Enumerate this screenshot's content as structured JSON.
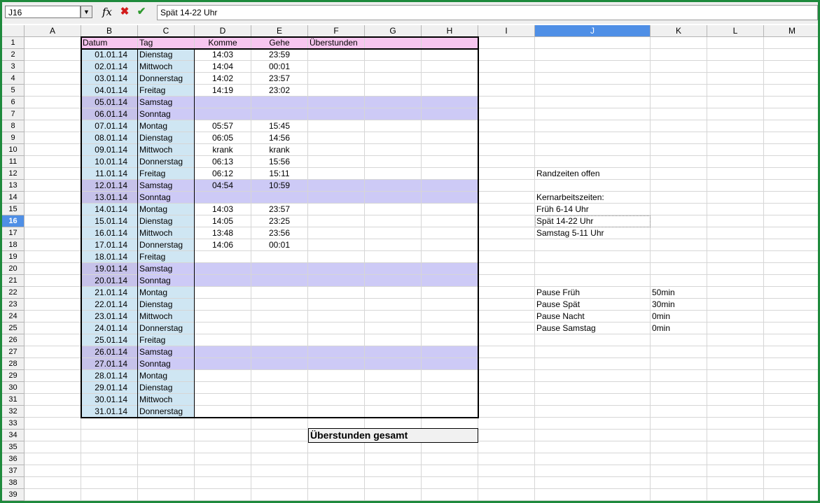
{
  "toolbar": {
    "cell_ref": "J16",
    "formula": "Spät 14-22 Uhr",
    "fx_icon": "function-wizard-icon",
    "cancel_icon": "cancel-x-icon",
    "accept_icon": "accept-check-icon"
  },
  "columns": [
    "A",
    "B",
    "C",
    "D",
    "E",
    "F",
    "G",
    "H",
    "I",
    "J",
    "K",
    "L",
    "M"
  ],
  "rows": [
    "1",
    "2",
    "3",
    "4",
    "5",
    "6",
    "7",
    "8",
    "9",
    "10",
    "11",
    "12",
    "13",
    "14",
    "15",
    "16",
    "17",
    "18",
    "19",
    "20",
    "21",
    "22",
    "23",
    "24",
    "25",
    "26",
    "27",
    "28",
    "29",
    "30",
    "31",
    "32",
    "33",
    "34",
    "35",
    "36",
    "37",
    "38",
    "39"
  ],
  "selected": {
    "column": "J",
    "row": "16"
  },
  "headers": {
    "datum": "Datum",
    "tag": "Tag",
    "komme": "Komme",
    "gehe": "Gehe",
    "ueberstunden": "Überstunden"
  },
  "entries": [
    {
      "date": "01.01.14",
      "day": "Dienstag",
      "in": "14:03",
      "out": "23:59",
      "weekend": false
    },
    {
      "date": "02.01.14",
      "day": "Mittwoch",
      "in": "14:04",
      "out": "00:01",
      "weekend": false
    },
    {
      "date": "03.01.14",
      "day": "Donnerstag",
      "in": "14:02",
      "out": "23:57",
      "weekend": false
    },
    {
      "date": "04.01.14",
      "day": "Freitag",
      "in": "14:19",
      "out": "23:02",
      "weekend": false
    },
    {
      "date": "05.01.14",
      "day": "Samstag",
      "in": "",
      "out": "",
      "weekend": true
    },
    {
      "date": "06.01.14",
      "day": "Sonntag",
      "in": "",
      "out": "",
      "weekend": true
    },
    {
      "date": "07.01.14",
      "day": "Montag",
      "in": "05:57",
      "out": "15:45",
      "weekend": false
    },
    {
      "date": "08.01.14",
      "day": "Dienstag",
      "in": "06:05",
      "out": "14:56",
      "weekend": false
    },
    {
      "date": "09.01.14",
      "day": "Mittwoch",
      "in": "krank",
      "out": "krank",
      "weekend": false
    },
    {
      "date": "10.01.14",
      "day": "Donnerstag",
      "in": "06:13",
      "out": "15:56",
      "weekend": false
    },
    {
      "date": "11.01.14",
      "day": "Freitag",
      "in": "06:12",
      "out": "15:11",
      "weekend": false
    },
    {
      "date": "12.01.14",
      "day": "Samstag",
      "in": "04:54",
      "out": "10:59",
      "weekend": true
    },
    {
      "date": "13.01.14",
      "day": "Sonntag",
      "in": "",
      "out": "",
      "weekend": true
    },
    {
      "date": "14.01.14",
      "day": "Montag",
      "in": "14:03",
      "out": "23:57",
      "weekend": false
    },
    {
      "date": "15.01.14",
      "day": "Dienstag",
      "in": "14:05",
      "out": "23:25",
      "weekend": false
    },
    {
      "date": "16.01.14",
      "day": "Mittwoch",
      "in": "13:48",
      "out": "23:56",
      "weekend": false
    },
    {
      "date": "17.01.14",
      "day": "Donnerstag",
      "in": "14:06",
      "out": "00:01",
      "weekend": false
    },
    {
      "date": "18.01.14",
      "day": "Freitag",
      "in": "",
      "out": "",
      "weekend": false
    },
    {
      "date": "19.01.14",
      "day": "Samstag",
      "in": "",
      "out": "",
      "weekend": true
    },
    {
      "date": "20.01.14",
      "day": "Sonntag",
      "in": "",
      "out": "",
      "weekend": true
    },
    {
      "date": "21.01.14",
      "day": "Montag",
      "in": "",
      "out": "",
      "weekend": false
    },
    {
      "date": "22.01.14",
      "day": "Dienstag",
      "in": "",
      "out": "",
      "weekend": false
    },
    {
      "date": "23.01.14",
      "day": "Mittwoch",
      "in": "",
      "out": "",
      "weekend": false
    },
    {
      "date": "24.01.14",
      "day": "Donnerstag",
      "in": "",
      "out": "",
      "weekend": false
    },
    {
      "date": "25.01.14",
      "day": "Freitag",
      "in": "",
      "out": "",
      "weekend": false
    },
    {
      "date": "26.01.14",
      "day": "Samstag",
      "in": "",
      "out": "",
      "weekend": true
    },
    {
      "date": "27.01.14",
      "day": "Sonntag",
      "in": "",
      "out": "",
      "weekend": true
    },
    {
      "date": "28.01.14",
      "day": "Montag",
      "in": "",
      "out": "",
      "weekend": false
    },
    {
      "date": "29.01.14",
      "day": "Dienstag",
      "in": "",
      "out": "",
      "weekend": false
    },
    {
      "date": "30.01.14",
      "day": "Mittwoch",
      "in": "",
      "out": "",
      "weekend": false
    },
    {
      "date": "31.01.14",
      "day": "Donnerstag",
      "in": "",
      "out": "",
      "weekend": false
    }
  ],
  "total_label": "Überstunden gesamt",
  "notes": {
    "randzeiten": "Randzeiten offen",
    "kern_title": "Kernarbeitszeiten:",
    "frueh": "Früh 6-14 Uhr",
    "spaet": "Spät 14-22 Uhr",
    "samstag": "Samstag 5-11 Uhr"
  },
  "pauses": [
    {
      "label": "Pause Früh",
      "value": "50min"
    },
    {
      "label": "Pause Spät",
      "value": "30min"
    },
    {
      "label": "Pause Nacht",
      "value": "0min"
    },
    {
      "label": "Pause Samstag",
      "value": "0min"
    }
  ],
  "colors": {
    "header_pink": "#f7c6ef",
    "date_blue": "#cfe6f3",
    "weekend_lavender": "#cdcaf6",
    "weekend_date": "#c6c2ea",
    "frame_green": "#1e8a3c",
    "selection_blue": "#4f8fe6"
  }
}
